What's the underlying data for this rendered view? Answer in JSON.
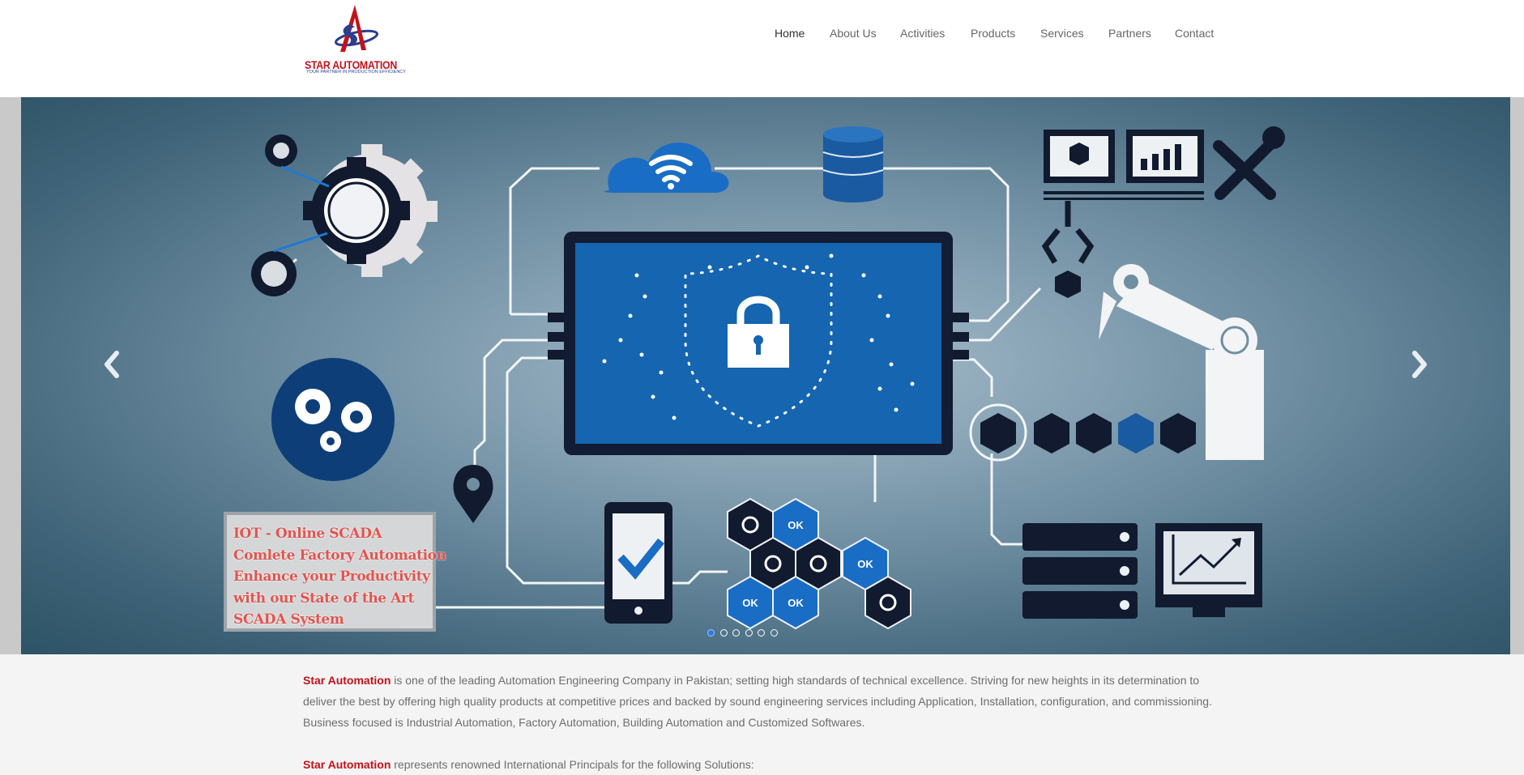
{
  "logo": {
    "title": "STAR AUTOMATION",
    "tagline": "YOUR PARTNER IN PRODUCTION EFFICIENCY"
  },
  "nav": {
    "items": [
      "Home",
      "About Us",
      "Activities",
      "Products",
      "Services",
      "Partners",
      "Contact"
    ],
    "active": "Home"
  },
  "slider": {
    "callout_lines": [
      "IOT  -  Online   SCADA",
      "Comlete Factory Automation",
      "Enhance your Productivity",
      "with our State of the Art",
      "SCADA System"
    ],
    "ok_label": "OK",
    "slide_count": 6,
    "active_slide": 1
  },
  "content": {
    "brand": "Star Automation",
    "paragraph1_text": " is one of the leading Automation Engineering Company in Pakistan; setting high standards of technical excellence. Striving for new heights in its determination to deliver the best by offering high quality products at competitive prices and backed by sound engineering services including Application, Installation, configuration, and commissioning. Business focused is Industrial Automation, Factory Automation, Building Automation and Customized Softwares.",
    "paragraph2_text": " represents renowned International Principals for the following Solutions:"
  },
  "colors": {
    "brand_red": "#c1121a",
    "callout_text": "#e0554f",
    "dark_navy": "#0f1c33",
    "screen_blue": "#1565b0",
    "dot_active": "#2f7ae0"
  },
  "icons": [
    "star-logo-icon",
    "gear-icon",
    "cloud-wifi-icon",
    "database-icon",
    "monitor-icon",
    "tools-icon",
    "robot-claw-icon",
    "robot-arm-icon",
    "cube-icon",
    "lock-icon",
    "location-pin-icon",
    "smartphone-check-icon",
    "hexagon-sync-icon",
    "server-icon",
    "chart-monitor-icon",
    "chevron-left-icon",
    "chevron-right-icon"
  ]
}
